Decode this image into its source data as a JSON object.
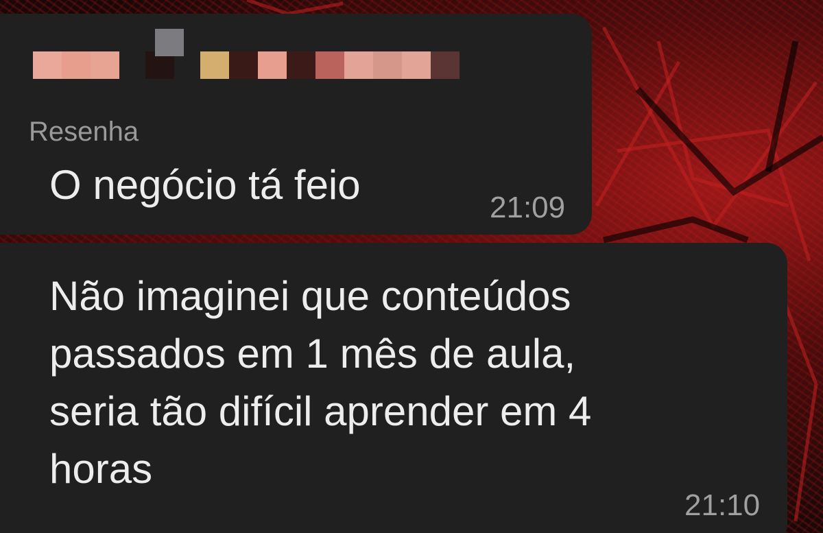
{
  "chat": {
    "messages": [
      {
        "sender_status": "Resenha",
        "text": "O negócio tá feio",
        "time": "21:09"
      },
      {
        "text": "Não imaginei que conteúdos\npassados em 1 mês de aula,\nseria tão difícil aprender em 4\nhoras",
        "time": "21:10"
      }
    ]
  },
  "colors": {
    "bubble": "#202020",
    "message_text": "#ededed",
    "secondary_text": "#9a9a9a",
    "wallpaper_accent": "#b81c1c",
    "redacted_name_blocks": [
      "#e9a89a",
      "#e79e8d",
      "#e7a493",
      "#231312",
      "#4a1f1c",
      "#d4ae6e",
      "#3a1a17",
      "#e79e8f",
      "#3b1a18",
      "#b9635c",
      "#e3a396",
      "#d6978b",
      "#e2a496",
      "#5b3533"
    ]
  },
  "icons": {
    "redacted_sender_name": "pixelated-name-mosaic"
  }
}
